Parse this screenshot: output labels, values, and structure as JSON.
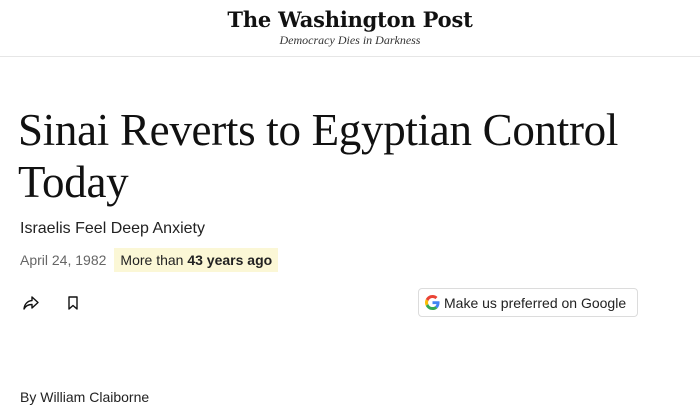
{
  "masthead": {
    "logo_text": "The Washington Post",
    "tagline": "Democracy Dies in Darkness"
  },
  "article": {
    "headline": "Sinai Reverts to Egyptian Control Today",
    "subhead": "Israelis Feel Deep Anxiety",
    "date": "April 24, 1982",
    "age_prefix": "More than ",
    "age_value": "43 years ago",
    "byline": "By William Claiborne"
  },
  "actions": {
    "share_icon": "share-arrow-icon",
    "bookmark_icon": "bookmark-icon",
    "google_button_label": "Make us preferred on Google",
    "google_icon": "google-g-icon"
  },
  "colors": {
    "badge_bg": "#fbf7d6",
    "google_blue": "#4285F4",
    "google_red": "#EA4335",
    "google_yellow": "#FBBC05",
    "google_green": "#34A853"
  }
}
